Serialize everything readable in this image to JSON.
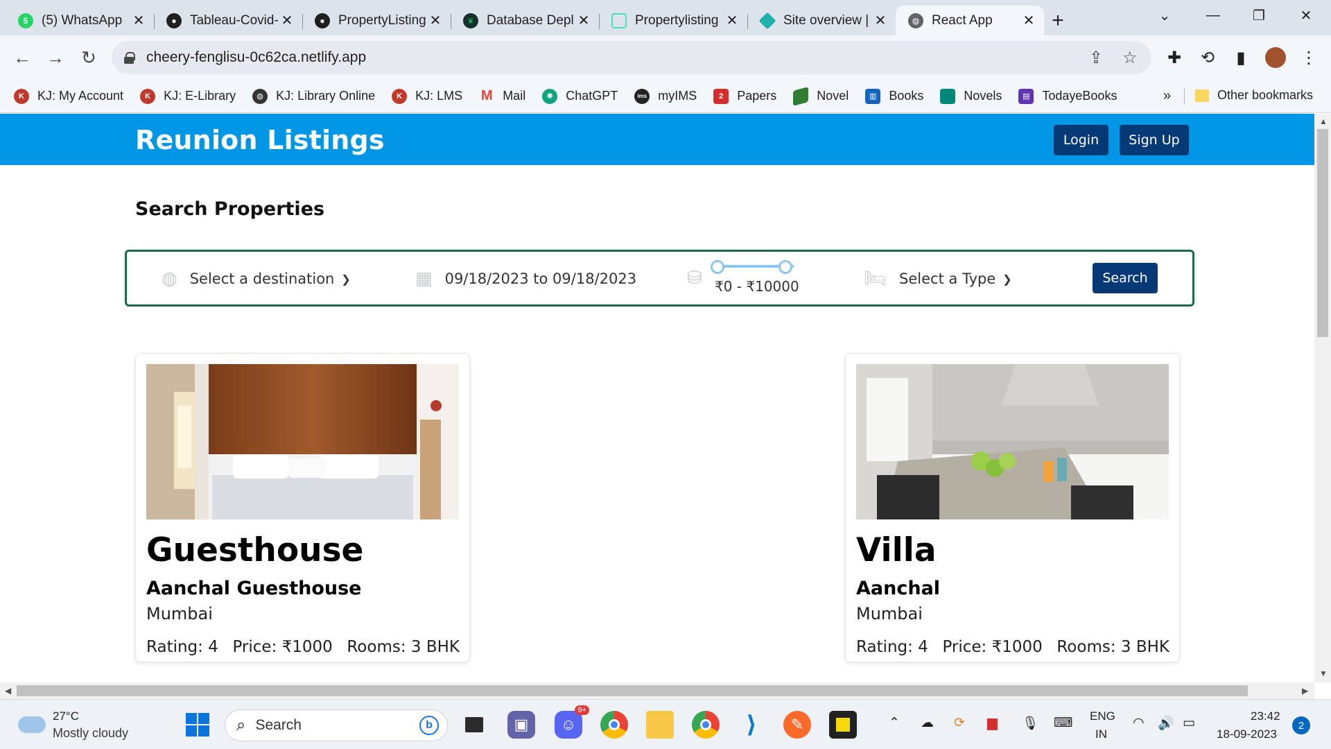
{
  "browser": {
    "tabs": [
      {
        "title": "(5) WhatsApp",
        "icon": "whatsapp-icon",
        "color": "#25d366"
      },
      {
        "title": "Tableau-Covid-",
        "icon": "github-icon",
        "color": "#1f1f1f"
      },
      {
        "title": "PropertyListing",
        "icon": "github-icon",
        "color": "#1f1f1f"
      },
      {
        "title": "Database Depl",
        "icon": "mongodb-icon",
        "color": "#13aa52"
      },
      {
        "title": "Propertylisting",
        "icon": "render-icon",
        "color": "#46e3b7"
      },
      {
        "title": "Site overview |",
        "icon": "netlify-icon",
        "color": "#20b2aa"
      },
      {
        "title": "React App",
        "icon": "globe-icon",
        "color": "#5f6368"
      }
    ],
    "active_tab": 6,
    "url": "cheery-fenglisu-0c62ca.netlify.app",
    "bookmarks": [
      {
        "label": "KJ: My Account",
        "icon": "kj-icon",
        "color": "#c0392b"
      },
      {
        "label": "KJ: E-Library",
        "icon": "kj-icon",
        "color": "#c0392b"
      },
      {
        "label": "KJ: Library Online",
        "icon": "globe-icon",
        "color": "#333333"
      },
      {
        "label": "KJ: LMS",
        "icon": "kj-icon",
        "color": "#c0392b"
      },
      {
        "label": "Mail",
        "icon": "gmail-icon",
        "color": "#ea4335"
      },
      {
        "label": "ChatGPT",
        "icon": "chatgpt-icon",
        "color": "#10a37f"
      },
      {
        "label": "myIMS",
        "icon": "ims-icon",
        "color": "#222222"
      },
      {
        "label": "Papers",
        "icon": "papers-icon",
        "color": "#d32f2f"
      },
      {
        "label": "Novel",
        "icon": "book-icon",
        "color": "#2e7d32"
      },
      {
        "label": "Books",
        "icon": "books-icon",
        "color": "#1565c0"
      },
      {
        "label": "Novels",
        "icon": "novel-icon",
        "color": "#00897b"
      },
      {
        "label": "TodayeBooks",
        "icon": "todayebooks-icon",
        "color": "#5e35b1"
      }
    ],
    "bookmarks_more": "»",
    "other_bookmarks": "Other bookmarks"
  },
  "app": {
    "brand": "Reunion Listings",
    "login_label": "Login",
    "signup_label": "Sign Up",
    "section_title": "Search Properties",
    "search": {
      "destination": "Select a destination",
      "dates": "09/18/2023 to 09/18/2023",
      "price_range": "₹0 - ₹10000",
      "type": "Select a Type",
      "button": "Search"
    },
    "listings": [
      {
        "type": "Guesthouse",
        "name": "Aanchal Guesthouse",
        "city": "Mumbai",
        "rating": "Rating: 4",
        "price": "Price: ₹1000",
        "rooms": "Rooms: 3 BHK"
      },
      {
        "type": "Villa",
        "name": "Aanchal",
        "city": "Mumbai",
        "rating": "Rating: 4",
        "price": "Price: ₹1000",
        "rooms": "Rooms: 3 BHK"
      }
    ],
    "colors": {
      "header": "#0096e6",
      "button": "#063a77",
      "search_border": "#1a6b46"
    }
  },
  "taskbar": {
    "temperature": "27°C",
    "weather": "Mostly cloudy",
    "search_placeholder": "Search",
    "discord_badge": "9+",
    "language": "ENG",
    "region": "IN",
    "time": "23:42",
    "date": "18-09-2023",
    "notifications": "2"
  }
}
